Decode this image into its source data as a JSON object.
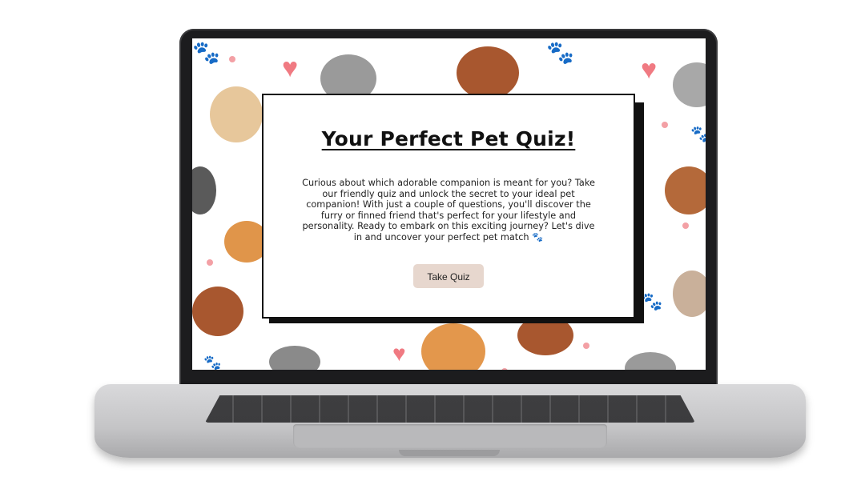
{
  "quiz": {
    "title": "Your Perfect Pet Quiz!",
    "description": "Curious about which adorable companion is meant for you? Take our friendly quiz and unlock the secret to your ideal pet companion! With just a couple of questions, you'll discover the furry or finned friend that's perfect for your lifestyle and personality. Ready to embark on this exciting journey? Let's dive in and uncover your perfect pet match 🐾",
    "button_label": "Take Quiz"
  },
  "icons": {
    "heart": "♥",
    "paw": "🐾"
  },
  "colors": {
    "button_bg": "#e7d7ce",
    "heart": "#f07a82",
    "laptop_bezel": "#1c1c1e"
  }
}
